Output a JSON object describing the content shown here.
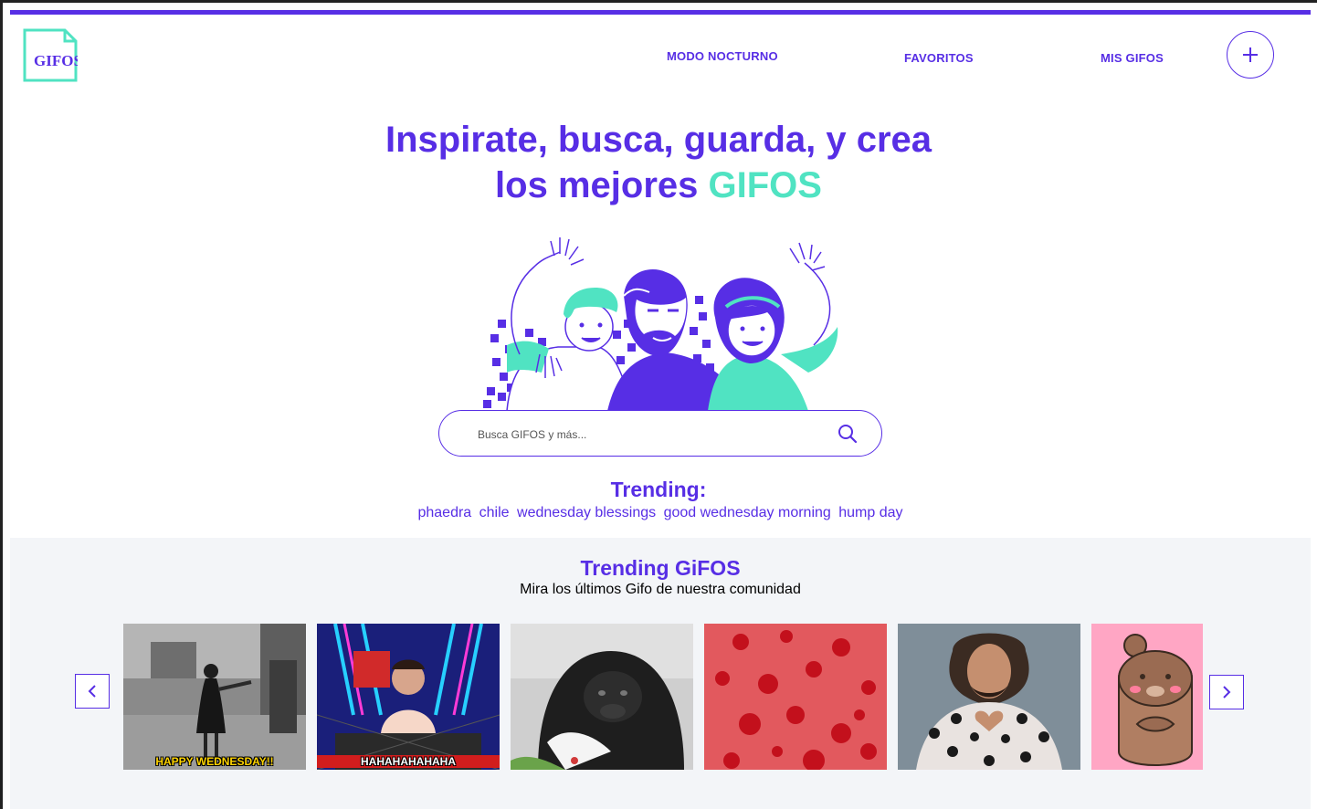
{
  "header": {
    "logo_text": "GIFOS",
    "nav": {
      "night_mode": "MODO NOCTURNO",
      "favorites": "FAVORITOS",
      "my_gifos": "MIS GIFOS"
    },
    "create_icon": "plus-icon"
  },
  "hero": {
    "title_line1": "Inspirate, busca, guarda, y crea",
    "title_line2_prefix": "los mejores ",
    "title_line2_accent": "GIFOS"
  },
  "search": {
    "placeholder": "Busca GIFOS y más...",
    "value": ""
  },
  "trending": {
    "label": "Trending:",
    "tags": [
      "phaedra",
      "chile",
      "wednesday blessings",
      "good wednesday morning",
      "hump day"
    ]
  },
  "trending_gifos": {
    "title": "Trending GiFOS",
    "subtitle": "Mira los últimos Gifo de nuestra comunidad",
    "gifs": [
      {
        "caption": "HAPPY WEDNESDAY!!"
      },
      {
        "caption": "HAHAHAHAHAHA"
      },
      {
        "caption": ""
      },
      {
        "caption": ""
      },
      {
        "caption": ""
      },
      {
        "caption": ""
      }
    ]
  },
  "colors": {
    "primary": "#572ee5",
    "accent": "#50e3c2",
    "section_bg": "#f3f5f8"
  }
}
